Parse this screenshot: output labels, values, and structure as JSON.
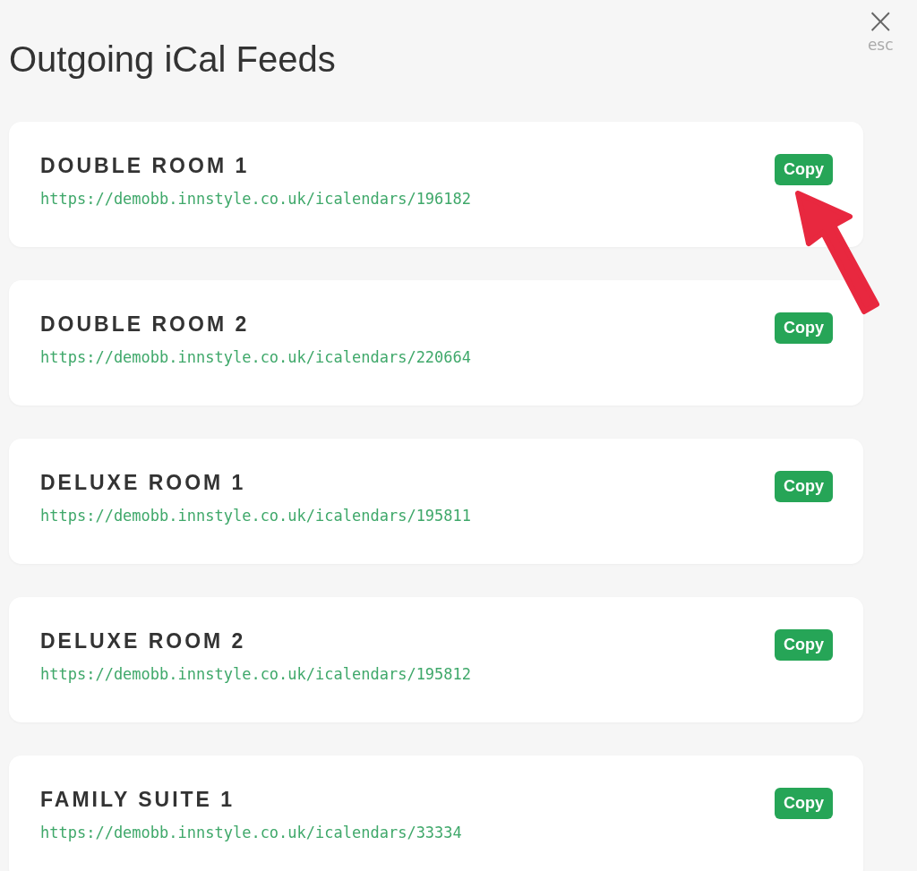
{
  "close": {
    "glyph": "×",
    "hint": "esc"
  },
  "title": "Outgoing iCal Feeds",
  "feeds": [
    {
      "name": "DOUBLE ROOM 1",
      "url": "https://demobb.innstyle.co.uk/icalendars/196182",
      "button": "Copy",
      "pointed_at": true
    },
    {
      "name": "DOUBLE ROOM 2",
      "url": "https://demobb.innstyle.co.uk/icalendars/220664",
      "button": "Copy",
      "pointed_at": false
    },
    {
      "name": "DELUXE ROOM 1",
      "url": "https://demobb.innstyle.co.uk/icalendars/195811",
      "button": "Copy",
      "pointed_at": false
    },
    {
      "name": "DELUXE ROOM 2",
      "url": "https://demobb.innstyle.co.uk/icalendars/195812",
      "button": "Copy",
      "pointed_at": false
    },
    {
      "name": "FAMILY SUITE 1",
      "url": "https://demobb.innstyle.co.uk/icalendars/33334",
      "button": "Copy",
      "pointed_at": false
    }
  ]
}
